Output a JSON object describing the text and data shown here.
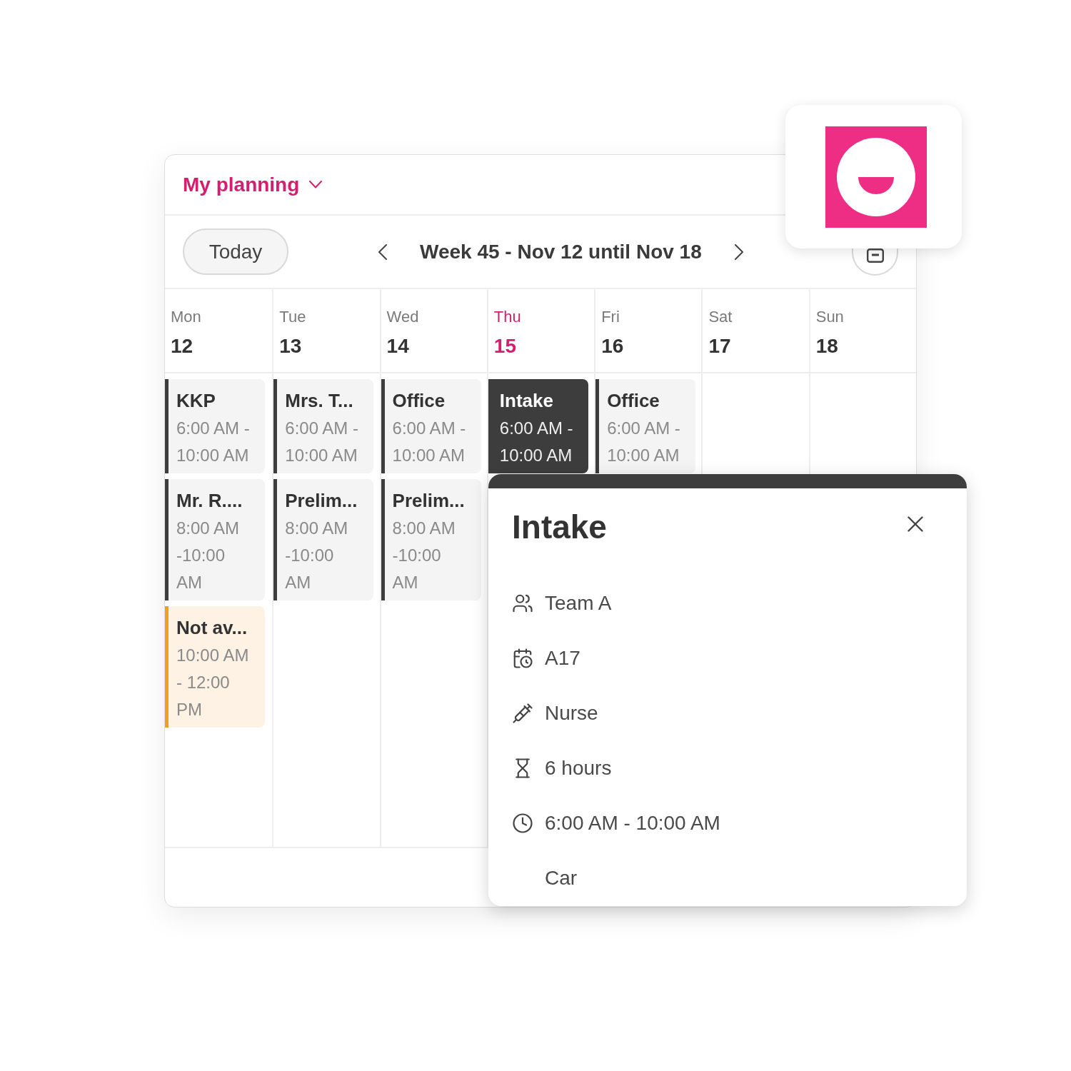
{
  "header": {
    "title": "My planning"
  },
  "toolbar": {
    "today_button": "Today",
    "week_label": "Week 45 - Nov 12 until Nov 18"
  },
  "days": [
    {
      "name": "Mon",
      "number": "12",
      "today": false,
      "events": [
        {
          "title": "KKP",
          "time": "6:00 AM - 10:00 AM",
          "kind": "appointment",
          "selected": false
        },
        {
          "title": "Mr. R....",
          "time": "8:00 AM -10:00 AM",
          "kind": "appointment",
          "selected": false
        },
        {
          "title": "Not av...",
          "time": "10:00 AM - 12:00 PM",
          "kind": "unavailable",
          "selected": false
        }
      ]
    },
    {
      "name": "Tue",
      "number": "13",
      "today": false,
      "events": [
        {
          "title": "Mrs. T...",
          "time": "6:00 AM - 10:00 AM",
          "kind": "appointment",
          "selected": false
        },
        {
          "title": "Prelim...",
          "time": "8:00 AM -10:00 AM",
          "kind": "appointment",
          "selected": false
        }
      ]
    },
    {
      "name": "Wed",
      "number": "14",
      "today": false,
      "events": [
        {
          "title": "Office",
          "time": "6:00 AM - 10:00 AM",
          "kind": "appointment",
          "selected": false
        },
        {
          "title": "Prelim...",
          "time": "8:00 AM -10:00 AM",
          "kind": "appointment",
          "selected": false
        }
      ]
    },
    {
      "name": "Thu",
      "number": "15",
      "today": true,
      "events": [
        {
          "title": "Intake",
          "time": "6:00 AM - 10:00 AM",
          "kind": "appointment",
          "selected": true
        }
      ]
    },
    {
      "name": "Fri",
      "number": "16",
      "today": false,
      "events": [
        {
          "title": "Office",
          "time": "6:00 AM - 10:00 AM",
          "kind": "appointment",
          "selected": false
        }
      ]
    },
    {
      "name": "Sat",
      "number": "17",
      "today": false
    },
    {
      "name": "Sun",
      "number": "18",
      "today": false
    }
  ],
  "popup": {
    "title": "Intake",
    "details": [
      {
        "kind": "team",
        "text": "Team A"
      },
      {
        "kind": "location",
        "text": "A17"
      },
      {
        "kind": "role",
        "text": "Nurse"
      },
      {
        "kind": "duration",
        "text": "6 hours"
      },
      {
        "kind": "time",
        "text": "6:00 AM - 10:00 AM"
      },
      {
        "kind": "note",
        "text": "Car"
      }
    ]
  }
}
